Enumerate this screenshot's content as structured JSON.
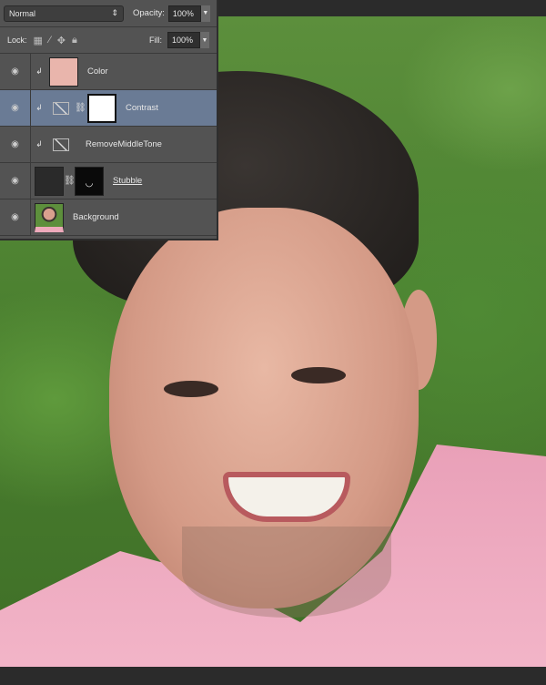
{
  "toolbar": {
    "blend_mode": "Normal",
    "opacity_label": "Opacity:",
    "opacity_value": "100%",
    "lock_label": "Lock:",
    "fill_label": "Fill:",
    "fill_value": "100%"
  },
  "layers": [
    {
      "name": "Color",
      "clipped": true,
      "thumb_color": "#e9b5ac"
    },
    {
      "name": "Contrast",
      "clipped": true,
      "selected": true
    },
    {
      "name": "RemoveMiddleTone",
      "clipped": true
    },
    {
      "name": "Stubble"
    },
    {
      "name": "Background"
    }
  ],
  "colors": {
    "panel": "#535353",
    "selected": "#6a7b95"
  }
}
